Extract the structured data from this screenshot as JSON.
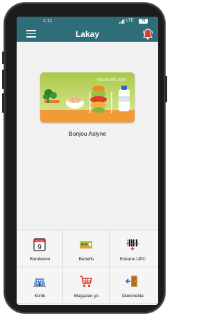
{
  "status_bar": {
    "time": "1:11",
    "network": "LTE",
    "battery": "78"
  },
  "app_bar": {
    "title": "Lakay",
    "menu_icon": "hamburger-menu-icon",
    "bell_icon": "notification-bell-icon"
  },
  "card": {
    "label": "Florida WIC EBT"
  },
  "greeting": "Bonjou Aslyne",
  "calendar_day": "9",
  "calendar_month": "Tuesday",
  "tiles": [
    {
      "label": "Randevou",
      "icon": "calendar-icon"
    },
    {
      "label": "Benefis",
      "icon": "benefits-card-icon"
    },
    {
      "label": "Eskane UPC",
      "icon": "barcode-scan-icon"
    },
    {
      "label": "Klinik",
      "icon": "clinic-building-icon"
    },
    {
      "label": "Magazen yo",
      "icon": "shopping-cart-icon"
    },
    {
      "label": "Dekonekte",
      "icon": "logout-door-icon"
    }
  ],
  "colors": {
    "brand": "#2f6e78",
    "alert": "#e0392f"
  }
}
